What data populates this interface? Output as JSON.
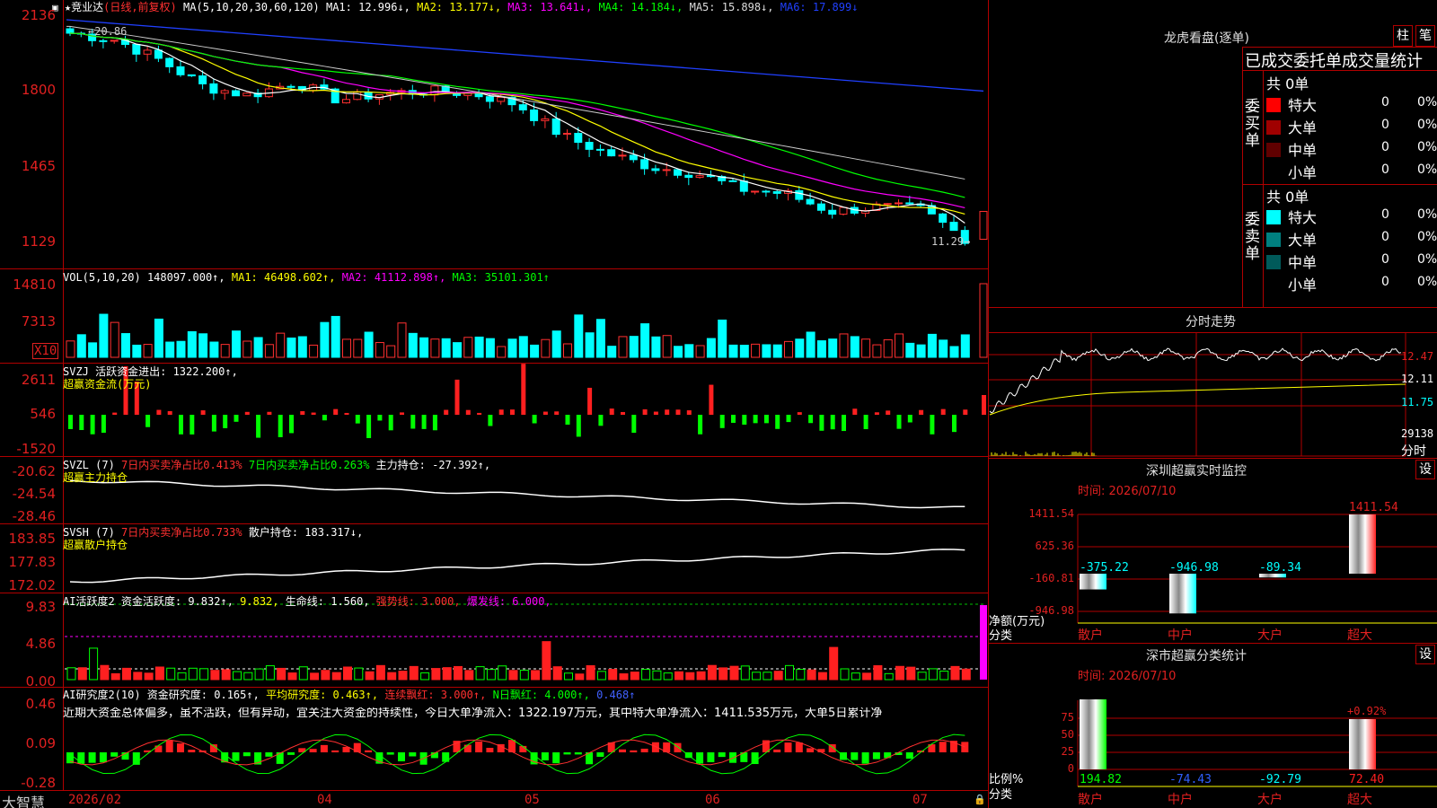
{
  "app": {
    "name": "大智慧"
  },
  "header": {
    "title": "★竞业达",
    "period": "(日线,前复权)",
    "ma_label": "MA(5,10,20,30,60,120)",
    "ma1": "MA1: 12.996↓,",
    "ma2": "MA2: 13.177↓,",
    "ma3": "MA3: 13.641↓,",
    "ma4": "MA4: 14.184↓,",
    "ma5": "MA5: 15.898↓,",
    "ma6": "MA6: 17.899↓",
    "hi_mark": "20.86",
    "lo_mark": "11.29→"
  },
  "price_axis": [
    "2136",
    "1800",
    "1465",
    "1129"
  ],
  "vol": {
    "header": "VOL(5,10,20)",
    "val": "148097.000↑,",
    "ma1": "MA1: 46498.602↑,",
    "ma2": "MA2: 41112.898↑,",
    "ma3": "MA3: 35101.301↑",
    "axis": [
      "14810",
      "7313"
    ],
    "unit": "X10"
  },
  "svzj": {
    "header": "SVZJ  活跃资金进出: 1322.200↑,",
    "sub": "超赢资金流(万元)",
    "axis": [
      "2611",
      "546",
      "-1520"
    ]
  },
  "svzl": {
    "header_a": "SVZL (7)",
    "header_b": "7日内买卖净占比0.413%",
    "header_c": "7日内买卖净占比0.263%",
    "header_d": "主力持仓: -27.392↑,",
    "sub": "超赢主力持仓",
    "axis": [
      "-20.62",
      "-24.54",
      "-28.46"
    ]
  },
  "svsh": {
    "header_a": "SVSH (7)",
    "header_b": "7日内买卖净占比0.733%",
    "header_c": "散户持仓: 183.317↓,",
    "sub": "超赢散户持仓",
    "axis": [
      "183.85",
      "177.83",
      "172.02"
    ]
  },
  "ai1": {
    "header_a": "AI活跃度2 资金活跃度: 9.832↑,",
    "header_b": "9.832,",
    "header_c": "生命线: 1.560,",
    "header_d": "强势线: 3.000,",
    "header_e": "爆发线: 6.000,",
    "axis": [
      "9.83",
      "4.86",
      "0.00"
    ]
  },
  "ai2": {
    "header_a": "AI研究度2(10) 资金研究度: 0.165↑,",
    "header_b": "平均研究度: 0.463↑,",
    "header_c": "连续飘红: 3.000↑,",
    "header_d": "N日飘红: 4.000↑,",
    "header_e": "0.468↑",
    "text": "近期大资金总体偏多，虽不活跃，但有异动，宜关注大资金的持续性，今日大单净流入：1322.197万元，其中特大单净流入：1411.535万元，大单5日累计净",
    "axis": [
      "0.46",
      "0.09",
      "-0.28"
    ]
  },
  "date_axis": [
    "2026/02",
    "04",
    "05",
    "06",
    "07"
  ],
  "right": {
    "lhkp": "龙虎看盘(逐单)",
    "btn1": "柱",
    "btn2": "笔",
    "stats_title": "已成交委托单成交量统计",
    "buy_label": "委买单",
    "sell_label": "委卖单",
    "buy_total": "共 0单",
    "sell_total": "共 0单",
    "buy_rows": [
      {
        "name": "特大",
        "val": "0",
        "pct": "0%",
        "color": "#ff0000"
      },
      {
        "name": "大单",
        "val": "0",
        "pct": "0%",
        "color": "#a00000"
      },
      {
        "name": "中单",
        "val": "0",
        "pct": "0%",
        "color": "#600000"
      },
      {
        "name": "小单",
        "val": "0",
        "pct": "0%",
        "color": "#000000"
      }
    ],
    "sell_rows": [
      {
        "name": "特大",
        "val": "0",
        "pct": "0%",
        "color": "#00ffff"
      },
      {
        "name": "大单",
        "val": "0",
        "pct": "0%",
        "color": "#008080"
      },
      {
        "name": "中单",
        "val": "0",
        "pct": "0%",
        "color": "#005a5a"
      },
      {
        "name": "小单",
        "val": "0",
        "pct": "0%",
        "color": "#000000"
      }
    ],
    "fszs": "分时走势",
    "fs_axis": [
      "12.47",
      "12.11",
      "11.75",
      "29138"
    ],
    "fs_unit": "分时",
    "szcy": "深圳超赢实时监控",
    "szcy_btn": "设",
    "szcy_date": "时间: 2026/07/10",
    "szcy_axis": [
      "1411.54",
      "625.36",
      "-160.81",
      "-946.98"
    ],
    "szcy_bars": [
      {
        "cat": "散户",
        "val": "-375.22",
        "color": "#00ffff"
      },
      {
        "cat": "中户",
        "val": "-946.98",
        "color": "#00ffff"
      },
      {
        "cat": "大户",
        "val": "-89.34",
        "color": "#00ffff"
      },
      {
        "cat": "超大",
        "val": "1411.54",
        "color": "#ff2020"
      }
    ],
    "szcy_label1": "净额(万元)",
    "szcy_label2": "分类",
    "sscy": "深市超赢分类统计",
    "sscy_btn": "设",
    "sscy_date": "时间: 2026/07/10",
    "sscy_axis": [
      "75",
      "50",
      "25",
      "0"
    ],
    "sscy_bars": [
      {
        "cat": "散户",
        "val": "194.82",
        "color": "#00ff00"
      },
      {
        "cat": "中户",
        "val": "-74.43",
        "color": "#3060ff"
      },
      {
        "cat": "大户",
        "val": "-92.79",
        "color": "#00ffff"
      },
      {
        "cat": "超大",
        "val": "72.40",
        "color": "#ff2020"
      }
    ],
    "sscy_top": "+0.92%",
    "sscy_label1": "比例%",
    "sscy_label2": "分类"
  }
}
